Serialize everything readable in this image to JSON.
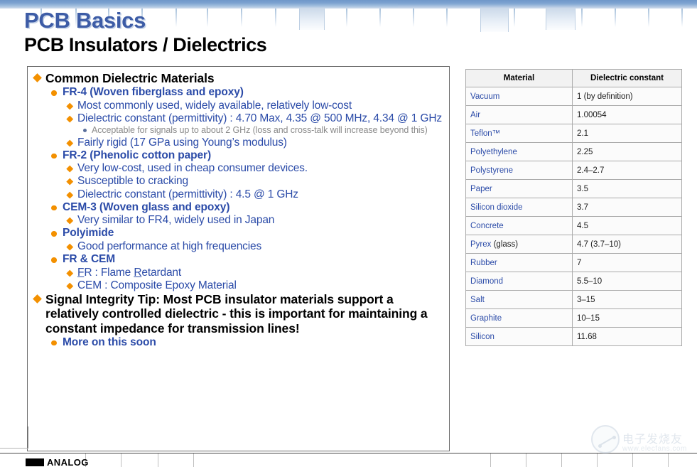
{
  "header": {
    "title": "PCB Basics",
    "subtitle": "PCB Insulators / Dielectrics",
    "title_color": "#3d5ca6",
    "subtitle_color": "#000000",
    "colorstrip": [
      "#3ba14a",
      "#7fbf3f",
      "#d4d62e",
      "#c9342b",
      "#d1562a",
      "#e0903c",
      "#8b4fa8",
      "#d04f9c",
      "#e8c13a",
      "#b52a2a",
      "#d6426b",
      "#2f6fc0",
      "#9fc1e0"
    ]
  },
  "content": {
    "bullets": [
      {
        "level": 1,
        "text": "Common Dielectric Materials"
      },
      {
        "level": 2,
        "text": "FR-4 (Woven fiberglass and epoxy)"
      },
      {
        "level": 3,
        "text": "Most commonly used, widely available, relatively low-cost"
      },
      {
        "level": 3,
        "text": "Dielectric constant (permittivity) : 4.70 Max, 4.35 @ 500 MHz, 4.34 @ 1 GHz"
      },
      {
        "level": 4,
        "text": "Acceptable for signals up to about 2 GHz (loss and cross-talk will increase beyond this)"
      },
      {
        "level": 3,
        "text": "Fairly rigid (17 GPa using Young’s modulus)"
      },
      {
        "level": 2,
        "text": "FR-2 (Phenolic cotton paper)"
      },
      {
        "level": 3,
        "text": "Very low-cost, used in cheap consumer devices."
      },
      {
        "level": 3,
        "text": "Susceptible to cracking"
      },
      {
        "level": 3,
        "text": "Dielectric constant (permittivity) : 4.5 @ 1 GHz"
      },
      {
        "level": 2,
        "text": "CEM-3 (Woven glass and epoxy)"
      },
      {
        "level": 3,
        "text": "Very similar to FR4, widely used in Japan"
      },
      {
        "level": 2,
        "text": "Polyimide"
      },
      {
        "level": 3,
        "text": "Good performance at high frequencies"
      },
      {
        "level": 2,
        "text": "FR & CEM"
      },
      {
        "level": 3,
        "text": "FR : Flame Retardant",
        "underline_chars": [
          "F",
          "R"
        ]
      },
      {
        "level": 3,
        "text": "CEM : Composite Epoxy Material"
      },
      {
        "level": 1,
        "text": "Signal Integrity Tip: Most PCB insulator materials support a relatively controlled dielectric  - this is important for maintaining a constant impedance for transmission lines!"
      },
      {
        "level": 2,
        "text": "More on this soon"
      }
    ],
    "bullet_colors": {
      "level1": "#f39000",
      "level2": "#f39000",
      "level3": "#f39000",
      "level4": "#5a6f9c"
    },
    "text_colors": {
      "level1": "#000000",
      "level2": "#2b4ba8",
      "level3": "#2b4ba8",
      "level4": "#8a8a8a"
    }
  },
  "table": {
    "headers": [
      "Material",
      "Dielectric constant"
    ],
    "rows": [
      {
        "material": "Vacuum",
        "material_note": "",
        "value": "1 (by definition)"
      },
      {
        "material": "Air",
        "material_note": "",
        "value": "1.00054"
      },
      {
        "material": "Teflon™",
        "material_note": "",
        "value": "2.1"
      },
      {
        "material": "Polyethylene",
        "material_note": "",
        "value": "2.25"
      },
      {
        "material": "Polystyrene",
        "material_note": "",
        "value": "2.4–2.7"
      },
      {
        "material": "Paper",
        "material_note": "",
        "value": "3.5"
      },
      {
        "material": "Silicon dioxide",
        "material_note": "",
        "value": "3.7"
      },
      {
        "material": "Concrete",
        "material_note": "",
        "value": "4.5"
      },
      {
        "material": "Pyrex",
        "material_note": " (glass)",
        "value": "4.7 (3.7–10)"
      },
      {
        "material": "Rubber",
        "material_note": "",
        "value": "7"
      },
      {
        "material": "Diamond",
        "material_note": "",
        "value": "5.5–10"
      },
      {
        "material": "Salt",
        "material_note": "",
        "value": "3–15"
      },
      {
        "material": "Graphite",
        "material_note": "",
        "value": "10–15"
      },
      {
        "material": "Silicon",
        "material_note": "",
        "value": "11.68"
      }
    ],
    "link_color": "#2b4ba8",
    "header_bg": "#f2f2f2"
  },
  "footer": {
    "logo_text": "ANALOG"
  },
  "watermark": {
    "chinese": "电子发烧友",
    "url": "www.elecfans.com"
  }
}
